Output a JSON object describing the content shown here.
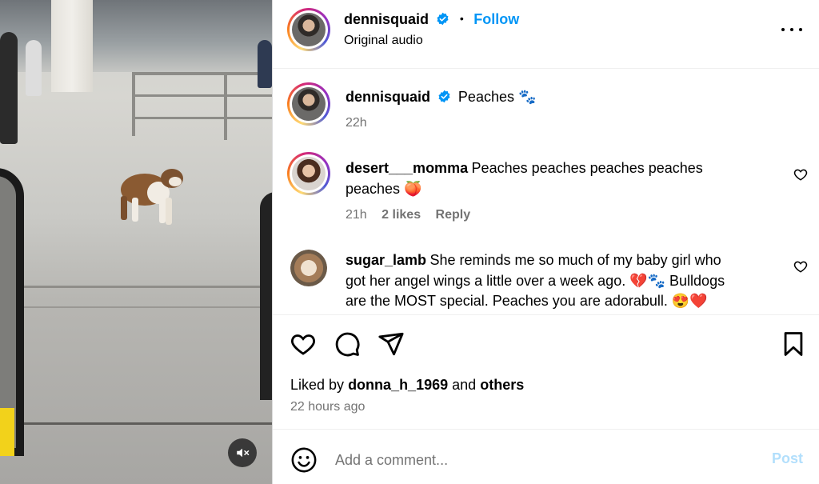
{
  "post": {
    "author": "dennisquaid",
    "follow_label": "Follow",
    "separator": "•",
    "audio": "Original audio"
  },
  "caption": {
    "author": "dennisquaid",
    "text": "Peaches 🐾",
    "time": "22h"
  },
  "comments": [
    {
      "author": "desert___momma",
      "text_line1": "Peaches peaches peaches peaches",
      "text_line2": "peaches 🍑",
      "time": "21h",
      "likes": "2 likes",
      "reply": "Reply"
    },
    {
      "author": "sugar_lamb",
      "text_line1": "She reminds me so much of my baby girl who",
      "text_line2": "got her angel wings a little over a week ago. 💔🐾 Bulldogs",
      "text_line3": "are the MOST special. Peaches you are adorabull. 😍❤️"
    }
  ],
  "likes": {
    "prefix": "Liked by",
    "user": "donna_h_1969",
    "middle": "and",
    "others": "others"
  },
  "timestamp": "22 hours ago",
  "composer": {
    "placeholder": "Add a comment...",
    "post_label": "Post"
  },
  "icons": {
    "like": "heart-icon",
    "comment": "comment-bubble-icon",
    "share": "paper-plane-icon",
    "save": "bookmark-icon",
    "emoji": "emoji-icon",
    "mute": "volume-muted-icon",
    "more": "more-options-icon",
    "verified": "verified-badge-icon"
  },
  "colors": {
    "link_blue": "#0095f6",
    "verified_blue": "#0095f6",
    "muted_text": "#737373",
    "post_disabled": "#b2dffc"
  }
}
